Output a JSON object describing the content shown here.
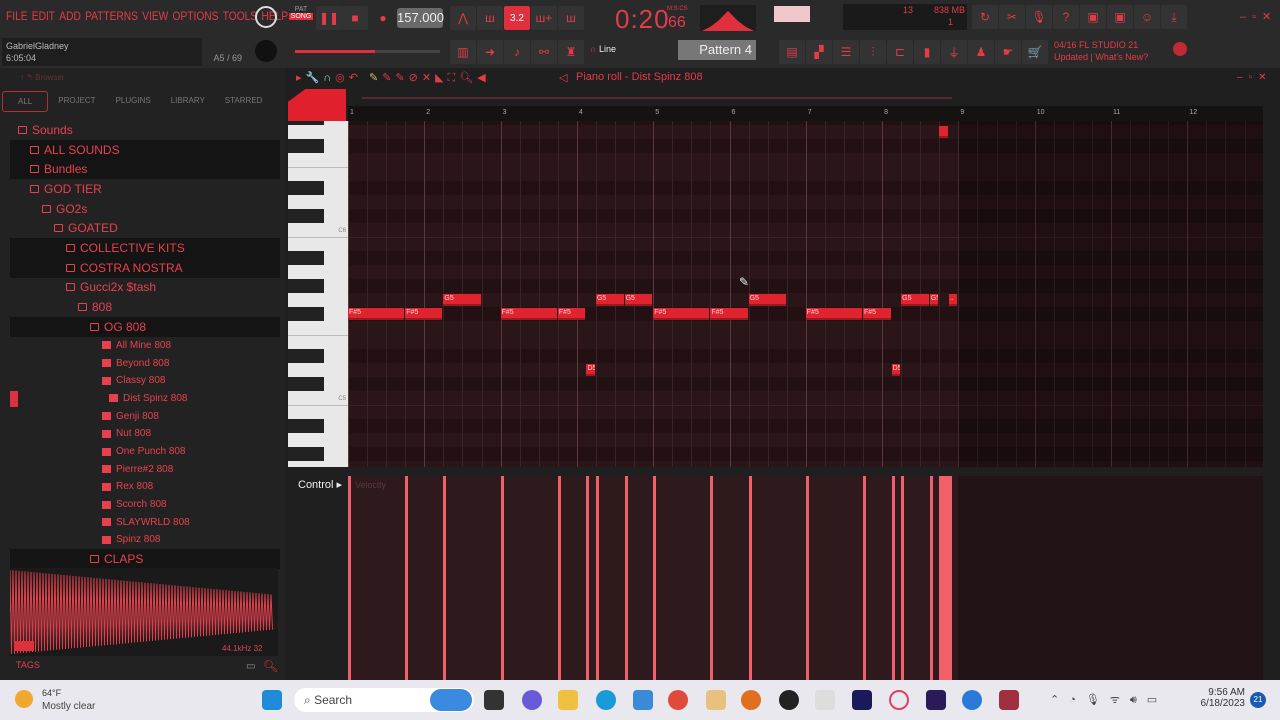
{
  "menu": [
    "FILE",
    "EDIT",
    "ADD",
    "PATTERNS",
    "VIEW",
    "OPTIONS",
    "TOOLS",
    "HELP"
  ],
  "hint": {
    "user": "GabrielGladney",
    "time": "6:05:04",
    "key": "A5 / 69"
  },
  "transport": {
    "pat": "PAT",
    "song": "SONG",
    "bpm": "157.000",
    "time": "0:20",
    "time_sub": "66",
    "time_format": "M:S:CS",
    "step": "3.2"
  },
  "perf": {
    "cpu": "13",
    "mem": "838 MB",
    "poly": "1"
  },
  "pattern": "Pattern 4",
  "snap": "Line",
  "news": {
    "line1": "04/16  FL STUDIO 21",
    "line2": "Updated | What's New?"
  },
  "browser": {
    "title": "Browser",
    "tabs": [
      "ALL",
      "PROJECT",
      "PLUGINS",
      "LIBRARY",
      "STARRED"
    ],
    "items": [
      {
        "label": "Sounds",
        "lvl": 1,
        "type": "folder"
      },
      {
        "label": "ALL SOUNDS",
        "lvl": 2,
        "type": "folder",
        "dark": true
      },
      {
        "label": "Bundles",
        "lvl": 2,
        "type": "folder",
        "dark": true
      },
      {
        "label": "GOD TIER",
        "lvl": 2,
        "type": "folder"
      },
      {
        "label": "GO2s",
        "lvl": 3,
        "type": "folder"
      },
      {
        "label": "GOATED",
        "lvl": 4,
        "type": "folder"
      },
      {
        "label": "COLLECTIVE KITS",
        "lvl": 5,
        "type": "folder",
        "dark": true
      },
      {
        "label": "COSTRA NOSTRA",
        "lvl": 5,
        "type": "folder",
        "dark": true
      },
      {
        "label": "Gucci2x $tash",
        "lvl": 5,
        "type": "folder"
      },
      {
        "label": "808",
        "lvl": 6,
        "type": "folder"
      },
      {
        "label": "OG 808",
        "lvl": 7,
        "type": "folder",
        "dark": true
      }
    ],
    "files": [
      "All Mine 808",
      "Beyond 808",
      "Classy 808",
      "Dist Spinz 808",
      "Genji 808",
      "Nut 808",
      "One Punch 808",
      "Pierre#2 808",
      "Rex 808",
      "Scorch 808",
      "SLAYWRLD 808",
      "Spinz 808"
    ],
    "selected": "Dist Spinz 808",
    "after": "CLAPS",
    "sample_info": "44.1kHz 32",
    "tags": "TAGS"
  },
  "piano_roll": {
    "title": "Piano roll - Dist Spinz 808",
    "bars": [
      "1",
      "2",
      "3",
      "4",
      "5",
      "6",
      "7",
      "8",
      "9",
      "10",
      "11",
      "12"
    ],
    "key_labels": [
      "C6",
      "C5"
    ],
    "control": "Control",
    "control_param": "Velocity",
    "notes": [
      {
        "label": "F#5",
        "semi": 6,
        "beat": 0,
        "len": 3
      },
      {
        "label": "F#5",
        "semi": 6,
        "beat": 3,
        "len": 2
      },
      {
        "label": "G5",
        "semi": 7,
        "beat": 5,
        "len": 2
      },
      {
        "label": "F#5",
        "semi": 6,
        "beat": 8,
        "len": 3
      },
      {
        "label": "F#5",
        "semi": 6,
        "beat": 11,
        "len": 1.5
      },
      {
        "label": "D5",
        "semi": 2,
        "beat": 12.5,
        "len": 0.5
      },
      {
        "label": "G5",
        "semi": 7,
        "beat": 13,
        "len": 1.5
      },
      {
        "label": "G5",
        "semi": 7,
        "beat": 14.5,
        "len": 1.5
      },
      {
        "label": "F#5",
        "semi": 6,
        "beat": 16,
        "len": 3
      },
      {
        "label": "F#5",
        "semi": 6,
        "beat": 19,
        "len": 2
      },
      {
        "label": "G5",
        "semi": 7,
        "beat": 21,
        "len": 2
      },
      {
        "label": "F#5",
        "semi": 6,
        "beat": 24,
        "len": 3
      },
      {
        "label": "F#5",
        "semi": 6,
        "beat": 27,
        "len": 1.5
      },
      {
        "label": "D5",
        "semi": 2,
        "beat": 28.5,
        "len": 0.5
      },
      {
        "label": "G5",
        "semi": 7,
        "beat": 29,
        "len": 1.5
      },
      {
        "label": "G5",
        "semi": 7,
        "beat": 30.5,
        "len": 0.5
      },
      {
        "label": "..",
        "semi": 7,
        "beat": 31.5,
        "len": 0.5
      },
      {
        "label": "",
        "semi": 19,
        "beat": 31,
        "len": 0.5
      }
    ]
  },
  "taskbar": {
    "weather_temp": "64°F",
    "weather_desc": "Mostly clear",
    "search": "Search",
    "clock": "9:56 AM",
    "date": "6/18/2023",
    "badge": "21"
  }
}
